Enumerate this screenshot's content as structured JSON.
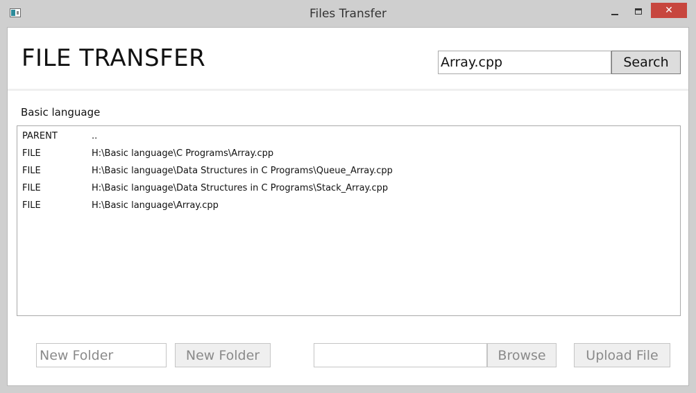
{
  "window": {
    "title": "Files Transfer",
    "minimize_label": "",
    "maximize_label": "",
    "close_label": "✕"
  },
  "header": {
    "title": "FILE TRANSFER",
    "search_value": "Array.cpp",
    "search_button": "Search"
  },
  "browser": {
    "current_folder": "Basic language",
    "entries": [
      {
        "type": "PARENT",
        "path": ".."
      },
      {
        "type": "FILE",
        "path": "H:\\Basic language\\C Programs\\Array.cpp"
      },
      {
        "type": "FILE",
        "path": "H:\\Basic language\\Data Structures in C Programs\\Queue_Array.cpp"
      },
      {
        "type": "FILE",
        "path": "H:\\Basic language\\Data Structures in C Programs\\Stack_Array.cpp"
      },
      {
        "type": "FILE",
        "path": "H:\\Basic language\\Array.cpp"
      }
    ]
  },
  "footer": {
    "new_folder_placeholder": "New Folder",
    "new_folder_button": "New Folder",
    "upload_path_value": "",
    "browse_button": "Browse",
    "upload_button": "Upload File"
  },
  "colors": {
    "chrome": "#cfcfcf",
    "close_button": "#c7463e",
    "disabled_text": "#8a8a8a"
  }
}
